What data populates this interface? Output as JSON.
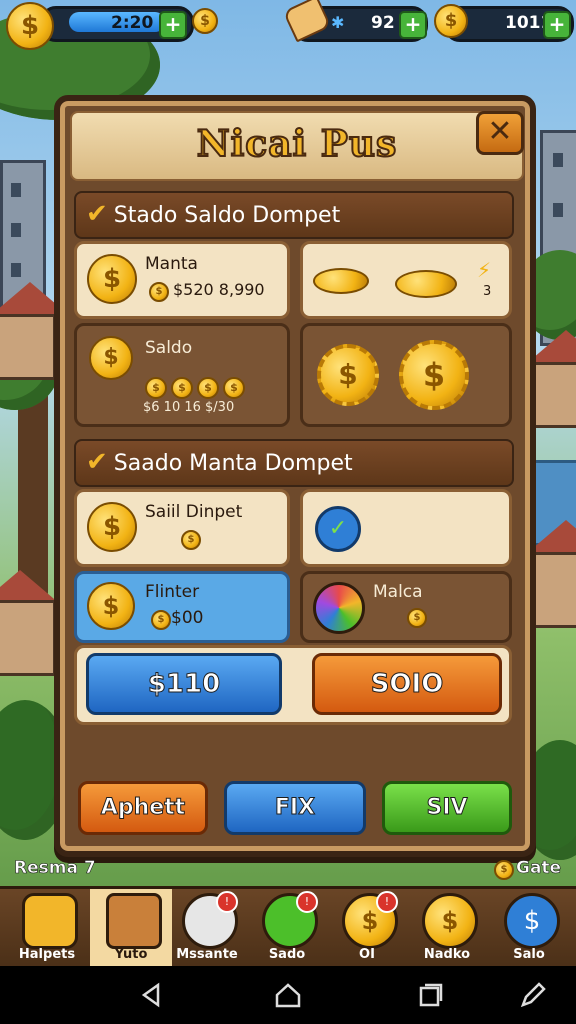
{
  "top": {
    "coins_value": "2:20",
    "gems_value": "92",
    "gold_value": "1011",
    "plus": "+"
  },
  "panel": {
    "title": "Nicai Pus",
    "close": "✕"
  },
  "section1": {
    "title": "Stado Saldo Dompet",
    "tile_manta_label": "Manta",
    "tile_manta_value": "$520 8,990",
    "tile_right_badge": "3",
    "tile_saldo_label": "Saldo",
    "tile_saldo_values": "$6  10  16  $/30"
  },
  "section2": {
    "title": "Saado Manta Dompet",
    "tile_dompet_label": "Saiil Dinpet",
    "tile_flinter_label": "Flinter",
    "tile_flinter_value": "$00",
    "tile_malca_label": "Malca"
  },
  "buttons": {
    "blue_amount": "$110",
    "orange_amount": "SOIO",
    "apply": "Aphett",
    "fix": "FIX",
    "save": "SIV"
  },
  "footer": {
    "left_text": "Resma 7",
    "right_text": "Gate"
  },
  "nav": [
    {
      "label": "Halpets"
    },
    {
      "label": "Yuto"
    },
    {
      "label": "Mssante"
    },
    {
      "label": "Sado"
    },
    {
      "label": "OI"
    },
    {
      "label": "Nadko"
    },
    {
      "label": "Salo"
    }
  ],
  "colors": {
    "panel_wood": "#6e4a2c",
    "gold": "#f2b62a",
    "blue_button": "#2f7fd6",
    "orange_button": "#e8701a",
    "green_button": "#4cbf2a"
  }
}
